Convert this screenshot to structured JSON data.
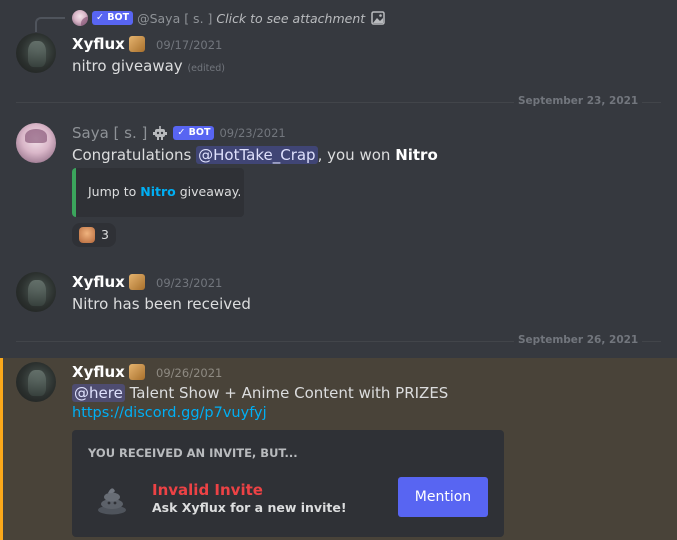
{
  "reply": {
    "bot_badge": "✓ BOT",
    "author": "@Saya [ s. ]",
    "text": "Click to see attachment"
  },
  "messages": [
    {
      "author": "Xyflux",
      "timestamp": "09/17/2021",
      "text": "nitro giveaway",
      "edited": "(edited)"
    },
    {
      "author": "Saya [ s. ]",
      "bot_badge": "✓ BOT",
      "timestamp": "09/23/2021",
      "text_prefix": "Congratulations",
      "mention": "@HotTake_Crap",
      "text_middle": ", you won",
      "text_bold": "Nitro",
      "embed": {
        "prefix": "Jump to",
        "highlight": "Nitro",
        "suffix": "giveaway."
      },
      "reaction_count": "3"
    },
    {
      "author": "Xyflux",
      "timestamp": "09/23/2021",
      "text": "Nitro has been received"
    },
    {
      "author": "Xyflux",
      "timestamp": "09/26/2021",
      "mention": "@here",
      "text": "Talent Show + Anime Content with PRIZES",
      "link": "https://discord.gg/p7vuyfyj",
      "invite": {
        "header": "YOU RECEIVED AN INVITE, BUT...",
        "title": "Invalid Invite",
        "subtitle": "Ask Xyflux for a new invite!",
        "button": "Mention"
      }
    }
  ],
  "dividers": [
    "September 23, 2021",
    "September 26, 2021"
  ],
  "colors": {
    "background": "#36393f",
    "accent": "#5865f2",
    "link": "#00aff4",
    "highlight_bar": "#faa81a",
    "invalid": "#ed4245",
    "embed_border": "#3ba55c"
  }
}
